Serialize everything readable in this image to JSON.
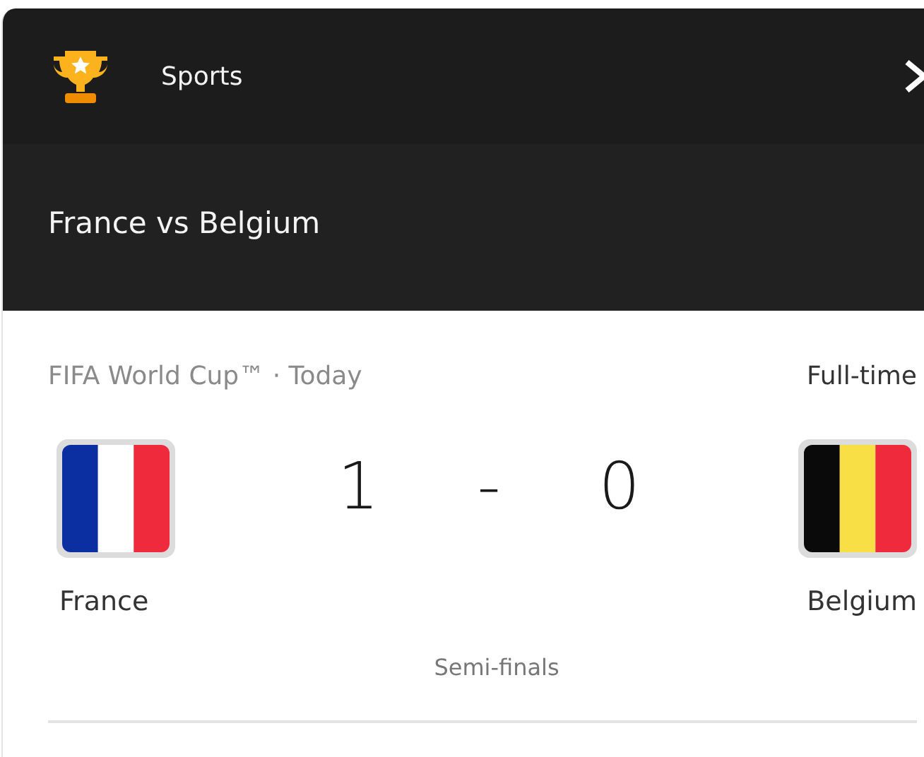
{
  "header": {
    "title": "Sports"
  },
  "match_title": "France vs Belgium",
  "match": {
    "competition": "FIFA World Cup™ · Today",
    "status": "Full-time",
    "home": {
      "name": "France",
      "score": "1"
    },
    "separator": "-",
    "away": {
      "name": "Belgium",
      "score": "0"
    },
    "stage": "Semi-finals"
  }
}
